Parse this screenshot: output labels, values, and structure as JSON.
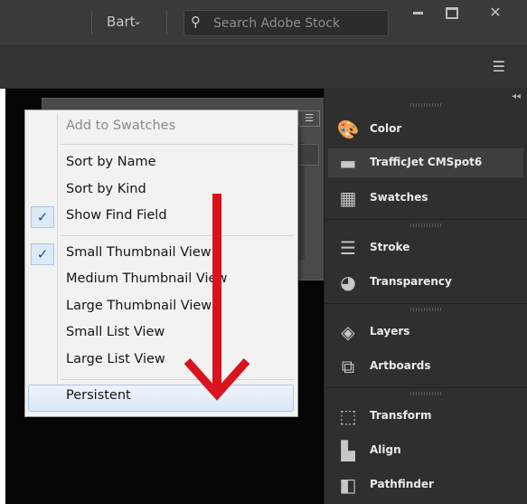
{
  "titlebar": {
    "user": "Bart",
    "user_menu_icon": "chevron-down-icon",
    "search_placeholder": "Search Adobe Stock",
    "search_icon": "search-icon"
  },
  "appbar": {
    "menu_icon": "panel-menu-icon"
  },
  "context_menu": {
    "items": [
      {
        "label": "Add to Swatches",
        "enabled": false,
        "checked": false
      },
      {
        "label": "Sort by Name",
        "enabled": true,
        "checked": false
      },
      {
        "label": "Sort by Kind",
        "enabled": true,
        "checked": false
      },
      {
        "label": "Show Find Field",
        "enabled": true,
        "checked": true
      },
      {
        "label": "Small Thumbnail View",
        "enabled": true,
        "checked": true
      },
      {
        "label": "Medium Thumbnail View",
        "enabled": true,
        "checked": false
      },
      {
        "label": "Large Thumbnail View",
        "enabled": true,
        "checked": false
      },
      {
        "label": "Small List View",
        "enabled": true,
        "checked": false
      },
      {
        "label": "Large List View",
        "enabled": true,
        "checked": false
      },
      {
        "label": "Persistent",
        "enabled": true,
        "checked": false,
        "highlighted": true
      }
    ],
    "check_glyph": "✓"
  },
  "dock": {
    "items": [
      {
        "label": "Color",
        "icon": "color-palette-icon"
      },
      {
        "label": "TrafficJet CMSpot6",
        "icon": "swatch-library-icon",
        "active": true
      },
      {
        "label": "Swatches",
        "icon": "swatches-grid-icon"
      },
      {
        "label": "Stroke",
        "icon": "stroke-lines-icon"
      },
      {
        "label": "Transparency",
        "icon": "transparency-circles-icon"
      },
      {
        "label": "Layers",
        "icon": "layers-icon"
      },
      {
        "label": "Artboards",
        "icon": "artboards-icon"
      },
      {
        "label": "Transform",
        "icon": "transform-icon"
      },
      {
        "label": "Align",
        "icon": "align-icon"
      },
      {
        "label": "Pathfinder",
        "icon": "pathfinder-icon"
      }
    ]
  },
  "annotation": {
    "arrow_color": "#d9141d",
    "arrow_icon": "down-arrow-icon"
  }
}
